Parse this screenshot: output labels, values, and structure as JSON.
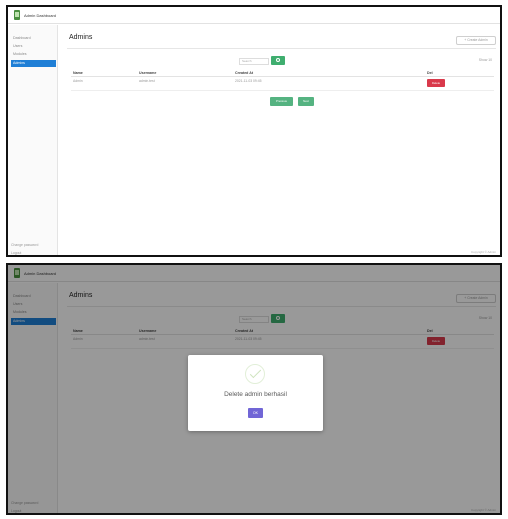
{
  "app": {
    "title": "Admin Dashboard"
  },
  "sidebar": {
    "items": [
      {
        "label": "Dashboard"
      },
      {
        "label": "Users"
      },
      {
        "label": "Modules"
      },
      {
        "label": "Admins"
      }
    ],
    "footer": [
      "Change password",
      "Logout"
    ]
  },
  "page": {
    "title": "Admins",
    "create_button": "+ Create Admin",
    "filter_placeholder": "Search",
    "page_size": "Show 10"
  },
  "table": {
    "headers": [
      "Name",
      "Username",
      "Created At",
      "Del"
    ],
    "rows": [
      {
        "name": "Admin",
        "username": "admin.test",
        "created_at": "2021-11-03 09:45",
        "delete_label": "Delete"
      }
    ]
  },
  "pagination": {
    "prev": "Previous",
    "next": "Next"
  },
  "footer": {
    "text": "Copyright © Admin"
  },
  "modal": {
    "message": "Delete admin berhasil",
    "ok_label": "OK"
  },
  "colors": {
    "accent": "#1f7fd6",
    "success": "#3fae6f",
    "danger": "#d9394b",
    "modal_button": "#7166d6"
  }
}
